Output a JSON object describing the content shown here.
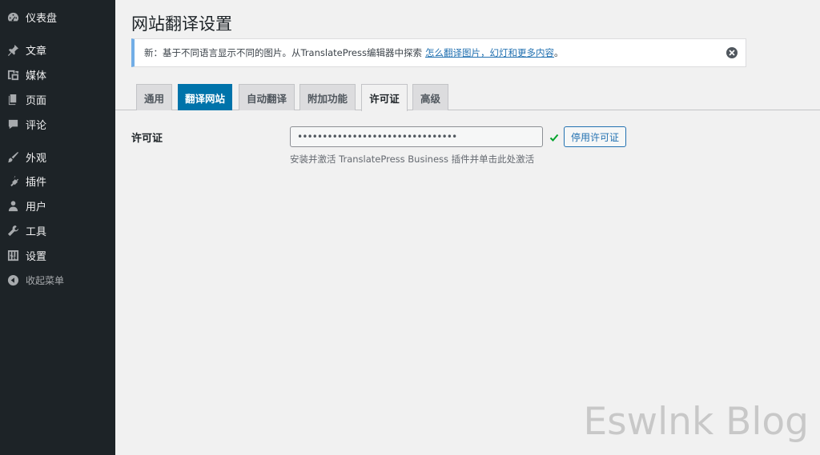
{
  "sidebar": {
    "items": [
      {
        "label": "仪表盘",
        "icon": "dashboard-icon"
      },
      {
        "label": "文章",
        "icon": "pin-icon"
      },
      {
        "label": "媒体",
        "icon": "media-icon"
      },
      {
        "label": "页面",
        "icon": "page-icon"
      },
      {
        "label": "评论",
        "icon": "comment-icon"
      },
      {
        "label": "外观",
        "icon": "brush-icon"
      },
      {
        "label": "插件",
        "icon": "plugin-icon"
      },
      {
        "label": "用户",
        "icon": "user-icon"
      },
      {
        "label": "工具",
        "icon": "wrench-icon"
      },
      {
        "label": "设置",
        "icon": "settings-icon"
      },
      {
        "label": "收起菜单",
        "icon": "collapse-icon"
      }
    ]
  },
  "page": {
    "title": "网站翻译设置"
  },
  "notice": {
    "text": "新：基于不同语言显示不同的图片。从TranslatePress编辑器中探索",
    "link": "怎么翻译图片，幻灯和更多内容",
    "suffix": "。"
  },
  "tabs": [
    {
      "label": "通用"
    },
    {
      "label": "翻译网站"
    },
    {
      "label": "自动翻译"
    },
    {
      "label": "附加功能"
    },
    {
      "label": "许可证"
    },
    {
      "label": "高级"
    }
  ],
  "license": {
    "label": "许可证",
    "value": "••••••••••••••••••••••••••••••••",
    "button": "停用许可证",
    "description": "安装并激活 TranslatePress Business 插件并单击此处激活"
  },
  "watermark": "Eswlnk Blog",
  "colors": {
    "sidebar_bg": "#1d2327",
    "accent_blue": "#0073aa",
    "link": "#2271b1",
    "check_green": "#00a32a"
  }
}
